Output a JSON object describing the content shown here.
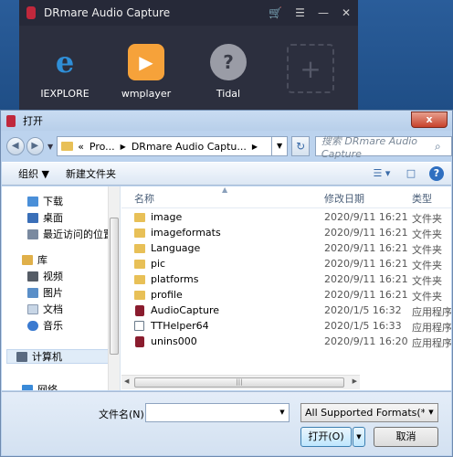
{
  "app": {
    "title": "DRmare Audio Capture",
    "controls": [
      "🛒",
      "☰",
      "—",
      "✕"
    ],
    "sources": [
      {
        "label": "IEXPLORE",
        "icon": "internet-explorer-icon"
      },
      {
        "label": "wmplayer",
        "icon": "windows-media-player-icon"
      },
      {
        "label": "Tidal",
        "icon": "tidal-icon"
      }
    ],
    "add_symbol": "+"
  },
  "dialog": {
    "title": "打开",
    "close": "x",
    "nav_back": "◀",
    "nav_forward": "▶",
    "nav_dropdown": "▼",
    "address": {
      "crumbs": [
        "«",
        "Pro...",
        "DRmare Audio Captu..."
      ],
      "sep": "▶",
      "dropdown": "▼"
    },
    "refresh": "↻",
    "search": {
      "placeholder": "搜索 DRmare Audio Capture",
      "icon": "⌕"
    },
    "toolbar": {
      "organize": "组织 ▼",
      "new_folder": "新建文件夹",
      "view": "☰ ▾",
      "preview": "□",
      "help": "?"
    },
    "nav_pane": [
      {
        "label": "下载",
        "icon": "downloads-icon",
        "color": "#4a8fd8"
      },
      {
        "label": "桌面",
        "icon": "desktop-icon",
        "color": "#3a6fb8"
      },
      {
        "label": "最近访问的位置",
        "icon": "recent-places-icon",
        "color": "#7a8aa0"
      },
      {
        "label": "库",
        "icon": "libraries-icon",
        "color": "#e0b04a"
      },
      {
        "label": "视频",
        "icon": "videos-icon",
        "color": "#555c66"
      },
      {
        "label": "图片",
        "icon": "pictures-icon",
        "color": "#5a8fc8"
      },
      {
        "label": "文档",
        "icon": "documents-icon",
        "color": "#c8d6e6"
      },
      {
        "label": "音乐",
        "icon": "music-icon",
        "color": "#3a7ad0"
      },
      {
        "label": "计算机",
        "icon": "computer-icon",
        "color": "#5a6a80"
      },
      {
        "label": "网络",
        "icon": "network-icon",
        "color": "#3a8ad8"
      }
    ],
    "columns": {
      "name": "名称",
      "modified": "修改日期",
      "type": "类型",
      "sort_arrow": "▲"
    },
    "files": [
      {
        "name": "image",
        "date": "2020/9/11 16:21",
        "type": "文件夹",
        "kind": "folder"
      },
      {
        "name": "imageformats",
        "date": "2020/9/11 16:21",
        "type": "文件夹",
        "kind": "folder"
      },
      {
        "name": "Language",
        "date": "2020/9/11 16:21",
        "type": "文件夹",
        "kind": "folder"
      },
      {
        "name": "pic",
        "date": "2020/9/11 16:21",
        "type": "文件夹",
        "kind": "folder"
      },
      {
        "name": "platforms",
        "date": "2020/9/11 16:21",
        "type": "文件夹",
        "kind": "folder"
      },
      {
        "name": "profile",
        "date": "2020/9/11 16:21",
        "type": "文件夹",
        "kind": "folder"
      },
      {
        "name": "AudioCapture",
        "date": "2020/1/5 16:32",
        "type": "应用程序",
        "kind": "app"
      },
      {
        "name": "TTHelper64",
        "date": "2020/1/5 16:33",
        "type": "应用程序",
        "kind": "exe"
      },
      {
        "name": "unins000",
        "date": "2020/9/11 16:20",
        "type": "应用程序",
        "kind": "app"
      }
    ],
    "hscroll": {
      "left": "◀",
      "right": "▶",
      "grip": "|||"
    },
    "filename_label": "文件名(N):",
    "filename_value": "",
    "filename_dropdown": "▼",
    "filter": "All Supported Formats(*.exe",
    "filter_dropdown": "▼",
    "open_button": "打开(O)",
    "open_split": "▼",
    "cancel_button": "取消"
  }
}
